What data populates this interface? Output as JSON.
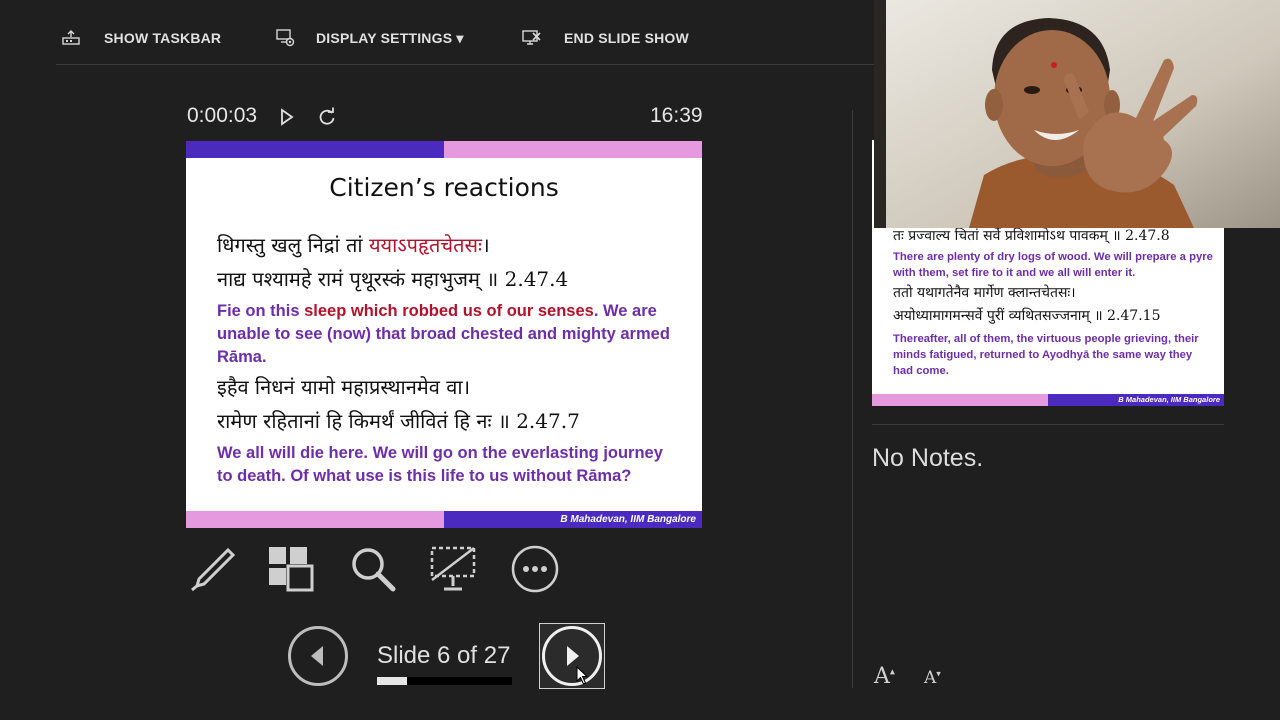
{
  "toolbar": {
    "show_taskbar": "SHOW TASKBAR",
    "display_settings": "DISPLAY SETTINGS ▾",
    "end_slide_show": "END SLIDE SHOW"
  },
  "timer": {
    "elapsed": "0:00:03",
    "clock": "16:39"
  },
  "current_slide": {
    "title": "Citizen’s reactions",
    "verse1_line1_a": "धिगस्तु खलु निद्रां तां ",
    "verse1_line1_red": "ययाऽपहृतचेतसः",
    "verse1_line1_b": "।",
    "verse1_line2": "नाद्य पश्यामहे रामं पृथूरस्कं महाभुजम् ॥ 2.47.4",
    "trans1_a": "Fie on this ",
    "trans1_red": "sleep which robbed us of our senses",
    "trans1_b": ". We are unable to see (now) that broad chested and mighty armed Rāma.",
    "verse2_line1": "इहैव निधनं यामो महाप्रस्थानमेव वा।",
    "verse2_line2": "रामेण रहितानां हि किमर्थं जीवितं हि नः ॥ 2.47.7",
    "trans2": "We all will die here. We will go on the everlasting journey to death. Of what use is this life to us without Rāma?",
    "footer": "B Mahadevan, IIM Bangalore"
  },
  "navigation": {
    "slide_counter": "Slide 6 of 27",
    "current": 6,
    "total": 27,
    "progress_fraction": 0.222
  },
  "next_slide": {
    "verse_line0": "तः प्रज्वाल्य चितां सर्वे प्रविशामोऽथ पावकम् ॥ 2.47.8",
    "trans1": "There are plenty of dry logs of wood. We will prepare a pyre with them, set fire to it and we all will enter it.",
    "verse_line1": "ततो यथागतेनैव मार्गेण क्लान्तचेतसः।",
    "verse_line2": "अयोध्यामागमन्सर्वे पुरीं व्यथितसज्जनाम् ॥ 2.47.15",
    "trans2": "Thereafter, all of them, the virtuous people grieving, their minds fatigued, returned to Ayodhyā the same way they had come.",
    "footer": "B Mahadevan, IIM Bangalore"
  },
  "notes": {
    "text": "No Notes."
  },
  "font_controls": {
    "increase": "A",
    "decrease": "A"
  },
  "colors": {
    "background": "#1f1f1f",
    "slide_purple": "#4b2bbf",
    "slide_pink": "#e59ae0",
    "text_purple": "#6d2ea8",
    "text_red": "#b3122b"
  }
}
